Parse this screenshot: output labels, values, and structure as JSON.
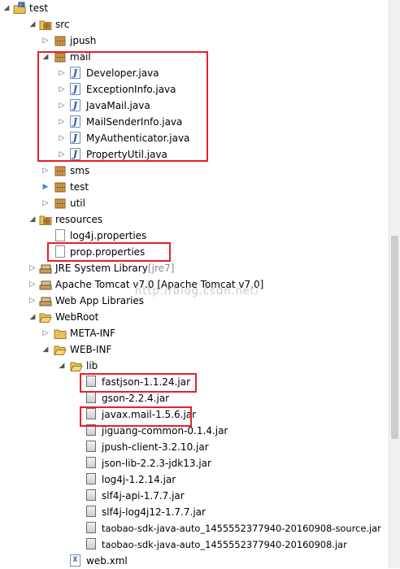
{
  "tree": {
    "project": "test",
    "src": {
      "label": "src",
      "packages": {
        "jpush": "jpush",
        "mail": "mail",
        "sms": "sms",
        "test": "test",
        "util": "util"
      },
      "mail_files": [
        "Developer.java",
        "ExceptionInfo.java",
        "JavaMail.java",
        "MailSenderInfo.java",
        "MyAuthenticator.java",
        "PropertyUtil.java"
      ]
    },
    "resources": {
      "label": "resources",
      "files": [
        "log4j.properties",
        "prop.properties"
      ]
    },
    "libraries": {
      "jre": "JRE System Library",
      "jre_decoration": "[jre7]",
      "tomcat": "Apache Tomcat v7.0 [Apache Tomcat v7.0]",
      "webapp": "Web App Libraries"
    },
    "webroot": {
      "label": "WebRoot",
      "meta_inf": "META-INF",
      "web_inf": "WEB-INF",
      "lib": "lib",
      "jars": [
        "fastjson-1.1.24.jar",
        "gson-2.2.4.jar",
        "javax.mail-1.5.6.jar",
        "jiguang-common-0.1.4.jar",
        "jpush-client-3.2.10.jar",
        "json-lib-2.2.3-jdk13.jar",
        "log4j-1.2.14.jar",
        "slf4j-api-1.7.7.jar",
        "slf4j-log4j12-1.7.7.jar",
        "taobao-sdk-java-auto_1455552377940-20160908-source.jar",
        "taobao-sdk-java-auto_1455552377940-20160908.jar"
      ],
      "web_xml": "web.xml"
    }
  },
  "watermark": "http://blog.csdn.net/",
  "colors": {
    "highlight": "#e8202a",
    "folder": "#e8c15a",
    "package": "#c98a3a"
  }
}
